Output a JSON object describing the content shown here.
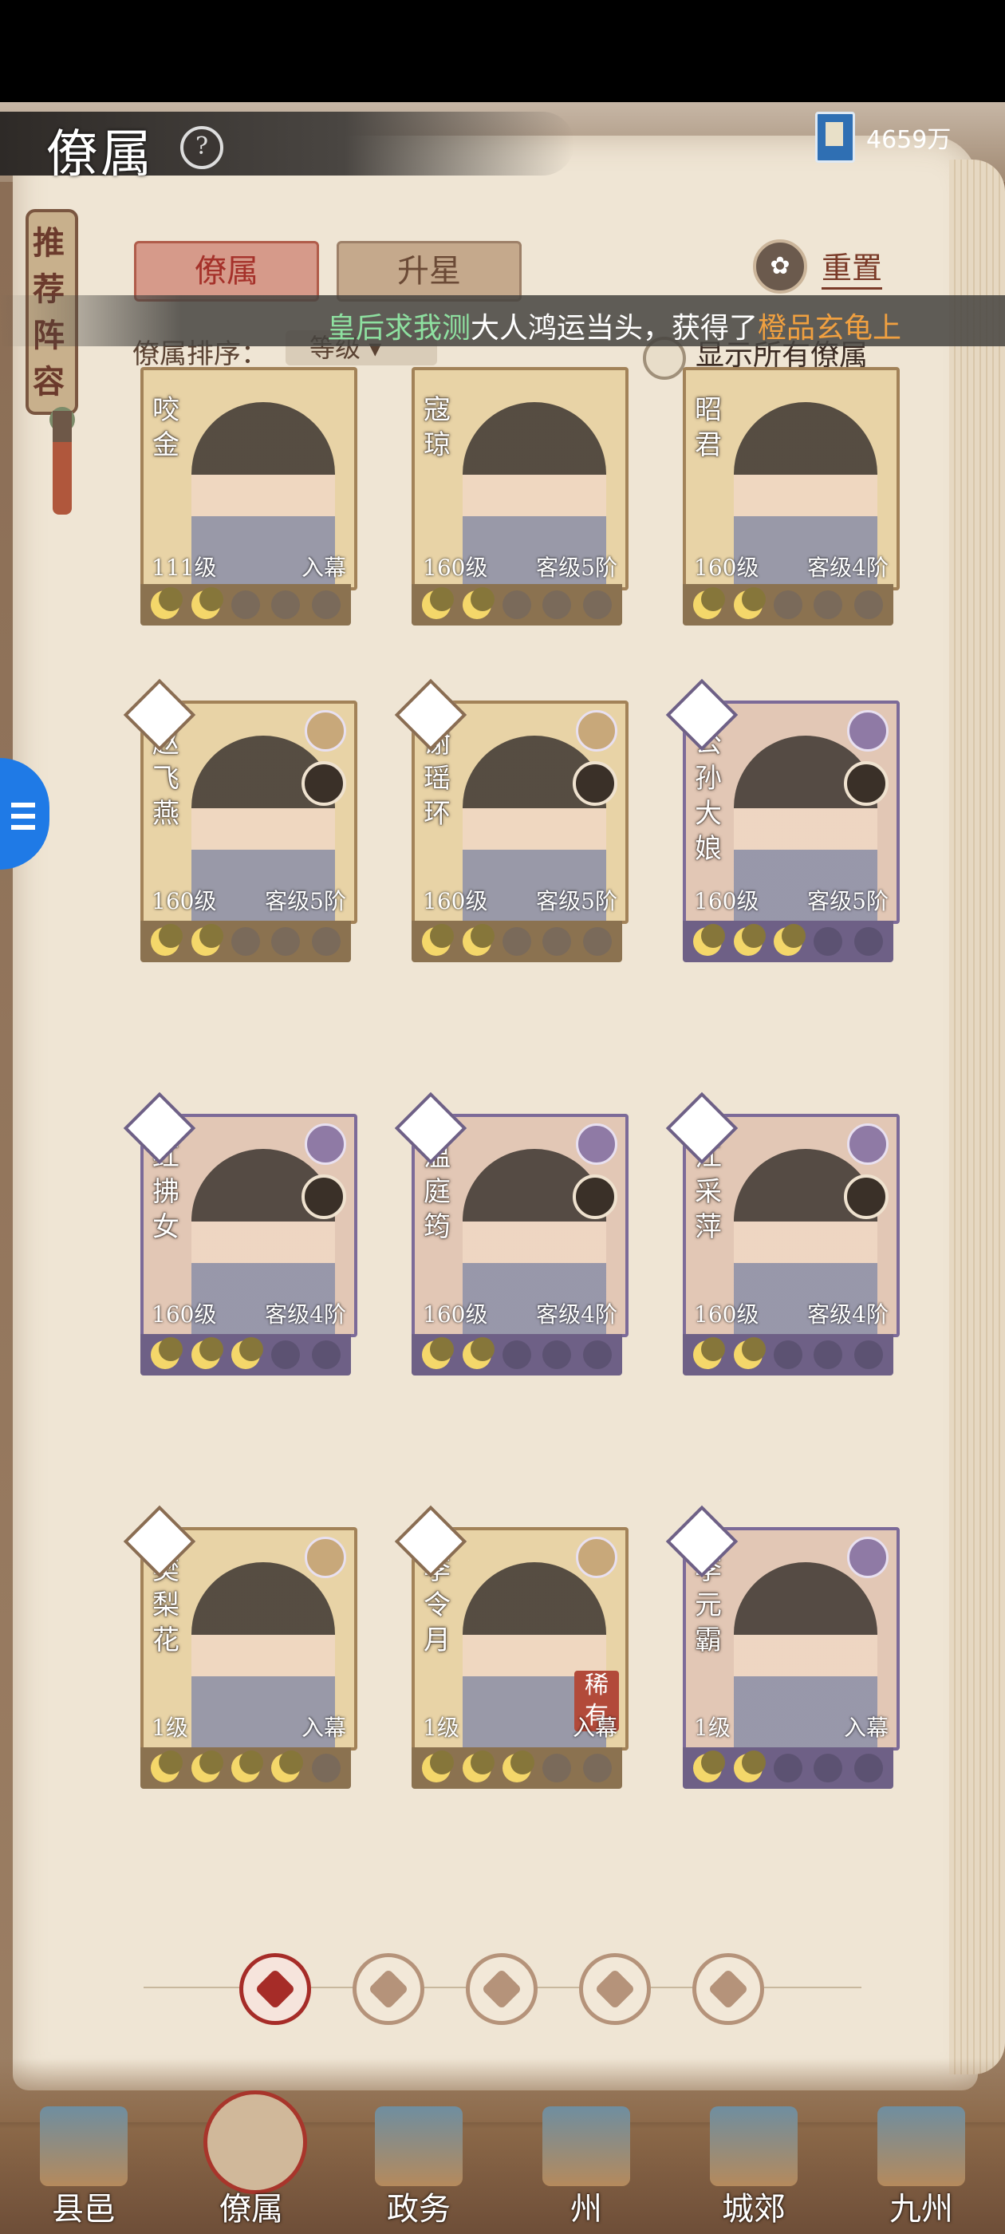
{
  "header": {
    "title": "僚属",
    "help": "?",
    "currency": "4659万"
  },
  "side_scroll": {
    "label": "推荐阵容"
  },
  "tabs": [
    {
      "label": "僚属"
    },
    {
      "label": "升星"
    }
  ],
  "reset_label": "重置",
  "sort": {
    "label": "僚属排序：",
    "value": "等级"
  },
  "show_all_label": "显示所有僚属",
  "marquee": {
    "p1": "皇后求我测",
    "p2": "大人鸿运当头，获得了",
    "p3": "橙品玄龟上"
  },
  "cards": [
    {
      "name": "咬金",
      "level": "111级",
      "rank": "入幕",
      "moons": 2
    },
    {
      "name": "寇琼",
      "level": "160级",
      "rank": "客级5阶",
      "moons": 2
    },
    {
      "name": "昭君",
      "level": "160级",
      "rank": "客级4阶",
      "moons": 2
    },
    {
      "name": "赵飞燕",
      "level": "160级",
      "rank": "客级5阶",
      "moons": 2
    },
    {
      "name": "谢瑶环",
      "level": "160级",
      "rank": "客级5阶",
      "moons": 2
    },
    {
      "name": "公孙大娘",
      "level": "160级",
      "rank": "客级5阶",
      "moons": 3
    },
    {
      "name": "红拂女",
      "level": "160级",
      "rank": "客级4阶",
      "moons": 3
    },
    {
      "name": "温庭筠",
      "level": "160级",
      "rank": "客级4阶",
      "moons": 2
    },
    {
      "name": "江采萍",
      "level": "160级",
      "rank": "客级4阶",
      "moons": 2
    },
    {
      "name": "樊梨花",
      "level": "1级",
      "rank": "入幕",
      "moons": 4
    },
    {
      "name": "李令月",
      "level": "1级",
      "rank": "入幕",
      "moons": 3,
      "rare": "稀有"
    },
    {
      "name": "李元霸",
      "level": "1级",
      "rank": "入幕",
      "moons": 2
    }
  ],
  "filters": [
    "all-icon",
    "bell-icon",
    "gourd-icon",
    "fan-icon",
    "lion-icon"
  ],
  "nav": [
    {
      "label": "县邑"
    },
    {
      "label": "僚属"
    },
    {
      "label": "政务"
    },
    {
      "label": "州"
    },
    {
      "label": "城郊"
    },
    {
      "label": "九州"
    }
  ]
}
